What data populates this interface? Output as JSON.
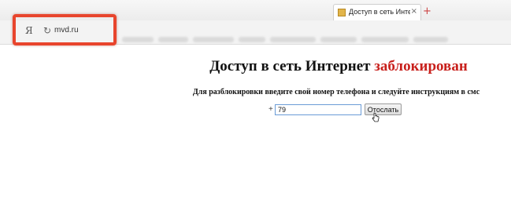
{
  "browser": {
    "tab": {
      "title": "Доступ в сеть Интернет",
      "close_glyph": "×",
      "favicon": "page-favicon"
    },
    "new_tab_glyph": "+",
    "toolbar": {
      "yandex_glyph": "Я",
      "reload_glyph": "↻",
      "address": "mvd.ru"
    }
  },
  "page": {
    "headline": "Доступ в сеть Интернет",
    "headline_highlight": "заблокирован",
    "instruction": "Для разблокировки введите свой номер телефона и следуйте инструкциям в смс",
    "phone_prefix": "+",
    "phone_value": "79",
    "send_button": "Отослать"
  },
  "colors": {
    "blocked_text": "#c8201c",
    "highlight_box": "#e8452d"
  }
}
